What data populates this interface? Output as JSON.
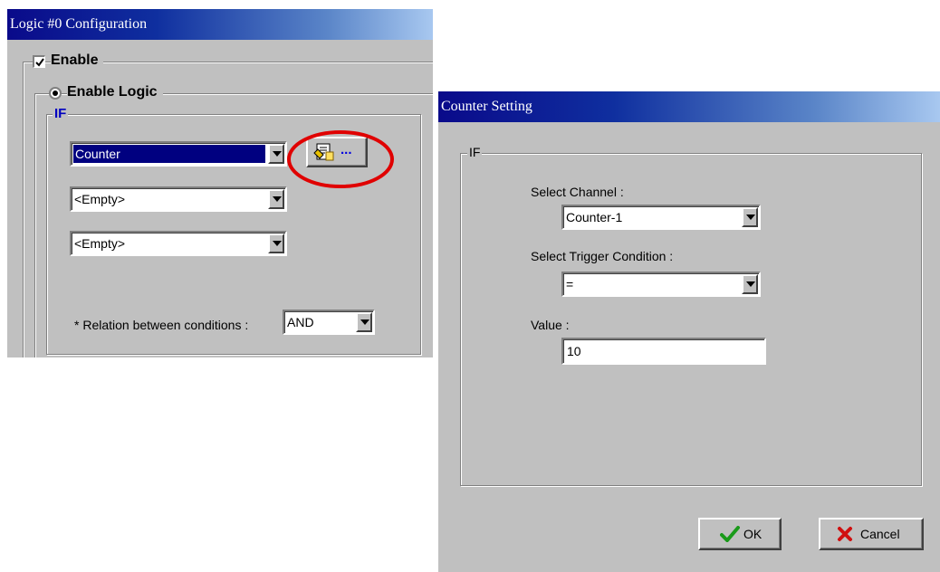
{
  "logic_window": {
    "title": "Logic #0 Configuration",
    "enable": {
      "label": "Enable",
      "checked": true
    },
    "enable_logic": {
      "label": "Enable Logic",
      "selected": true
    },
    "if_group": {
      "legend": "IF",
      "conditions": [
        {
          "value": "Counter",
          "selected": true
        },
        {
          "value": "<Empty>",
          "selected": false
        },
        {
          "value": "<Empty>",
          "selected": false
        }
      ],
      "settings_button": {
        "icon": "settings-document-icon",
        "label": "..."
      },
      "relation_label": "* Relation between conditions :",
      "relation_value": "AND"
    },
    "highlight_color": "#e00000"
  },
  "counter_window": {
    "title": "Counter Setting",
    "if_group": {
      "legend": "IF"
    },
    "channel": {
      "label": "Select Channel :",
      "value": "Counter-1"
    },
    "trigger": {
      "label": "Select Trigger Condition :",
      "value": "="
    },
    "value": {
      "label": "Value :",
      "current": "10"
    },
    "ok_button": {
      "label": "OK",
      "icon": "checkmark-icon"
    },
    "cancel_button": {
      "label": "Cancel",
      "icon": "cross-icon"
    }
  }
}
